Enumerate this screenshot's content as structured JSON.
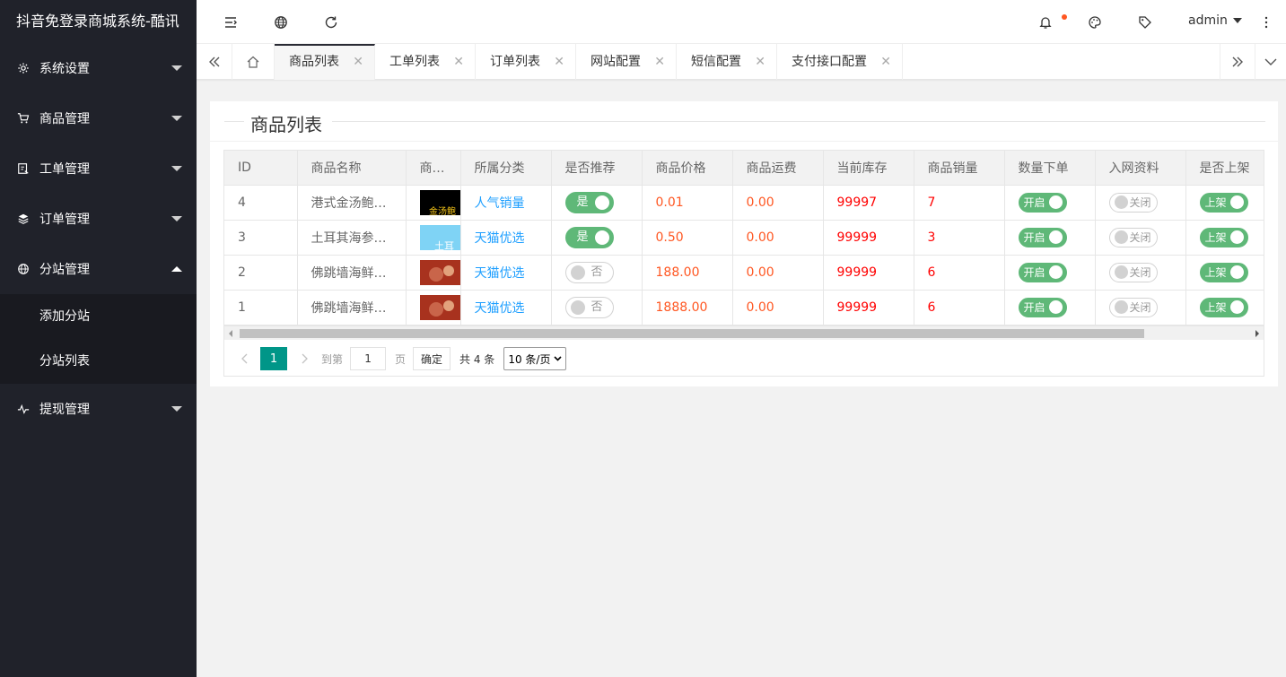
{
  "app": {
    "title": "抖音免登录商城系统-酷讯"
  },
  "sidebar": {
    "items": [
      {
        "label": "系统设置",
        "icon": "gear-icon",
        "expanded": false
      },
      {
        "label": "商品管理",
        "icon": "cart-icon",
        "expanded": false
      },
      {
        "label": "工单管理",
        "icon": "ticket-icon",
        "expanded": false
      },
      {
        "label": "订单管理",
        "icon": "layers-icon",
        "expanded": false
      },
      {
        "label": "分站管理",
        "icon": "globe-icon",
        "expanded": true
      },
      {
        "label": "提现管理",
        "icon": "pulse-icon",
        "expanded": false
      }
    ],
    "subitems": [
      {
        "label": "添加分站"
      },
      {
        "label": "分站列表"
      }
    ]
  },
  "header": {
    "user": "admin",
    "icons": [
      "menu-toggle-icon",
      "globe-icon",
      "refresh-icon",
      "bell-icon",
      "palette-icon",
      "tag-icon",
      "more-vertical-icon"
    ],
    "notification_dot_color": "#ff5722"
  },
  "tabs": [
    {
      "label": "商品列表",
      "active": true
    },
    {
      "label": "工单列表",
      "active": false
    },
    {
      "label": "订单列表",
      "active": false
    },
    {
      "label": "网站配置",
      "active": false
    },
    {
      "label": "短信配置",
      "active": false
    },
    {
      "label": "支付接口配置",
      "active": false
    }
  ],
  "page": {
    "title": "商品列表"
  },
  "table": {
    "columns": [
      "ID",
      "商品名称",
      "商…",
      "所属分类",
      "是否推荐",
      "商品价格",
      "商品运费",
      "当前库存",
      "商品销量",
      "数量下单",
      "入网资料",
      "是否上架"
    ],
    "rows": [
      {
        "id": "4",
        "name": "港式金汤鲍…",
        "thumb_text": "金汤鲍",
        "category": "人气销量",
        "recommend": "是",
        "price": "0.01",
        "freight": "0.00",
        "stock": "99997",
        "sales": "7",
        "qty_order": "开启",
        "network": "关闭",
        "listed": "上架"
      },
      {
        "id": "3",
        "name": "土耳其海参…",
        "thumb_text": "土耳",
        "category": "天猫优选",
        "recommend": "是",
        "price": "0.50",
        "freight": "0.00",
        "stock": "99999",
        "sales": "3",
        "qty_order": "开启",
        "network": "关闭",
        "listed": "上架"
      },
      {
        "id": "2",
        "name": "佛跳墙海鲜…",
        "thumb_text": "",
        "category": "天猫优选",
        "recommend": "否",
        "price": "188.00",
        "freight": "0.00",
        "stock": "99999",
        "sales": "6",
        "qty_order": "开启",
        "network": "关闭",
        "listed": "上架"
      },
      {
        "id": "1",
        "name": "佛跳墙海鲜…",
        "thumb_text": "",
        "category": "天猫优选",
        "recommend": "否",
        "price": "1888.00",
        "freight": "0.00",
        "stock": "99999",
        "sales": "6",
        "qty_order": "开启",
        "network": "关闭",
        "listed": "上架"
      }
    ]
  },
  "pager": {
    "current": "1",
    "goto_label": "到第",
    "goto_value": "1",
    "page_unit": "页",
    "confirm": "确定",
    "total": "共 4 条",
    "page_size": "10 条/页"
  },
  "colors": {
    "sidebar_bg": "#20222a",
    "switch_on": "#5fb878",
    "pager_active": "#009688",
    "price": "#ff5722",
    "stock": "#ff0000",
    "category_link": "#1e9fff"
  }
}
